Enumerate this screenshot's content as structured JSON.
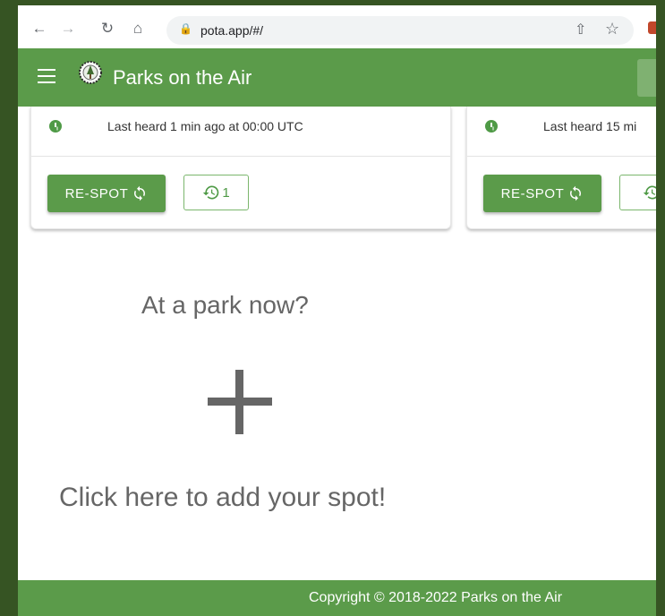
{
  "browser": {
    "url": "pota.app/#/",
    "back_icon": "←",
    "forward_icon": "→",
    "reload_icon": "↻",
    "home_icon": "⌂",
    "share_icon": "⇧",
    "star_icon": "☆"
  },
  "header": {
    "title": "Parks on the Air"
  },
  "cards": [
    {
      "last_heard": "Last heard 1 min ago at 00:00 UTC",
      "respot_label": "RE-SPOT",
      "history_count": "1"
    },
    {
      "last_heard": "Last heard 15 mi",
      "respot_label": "RE-SPOT",
      "history_count": ""
    }
  ],
  "add_spot": {
    "prompt": "At a park now?",
    "action": "Click here to add your spot!"
  },
  "footer": {
    "copyright": "Copyright © 2018-2022 Parks on the Air"
  },
  "colors": {
    "brand_green": "#5b9b4a",
    "frame_dark": "#365423"
  }
}
